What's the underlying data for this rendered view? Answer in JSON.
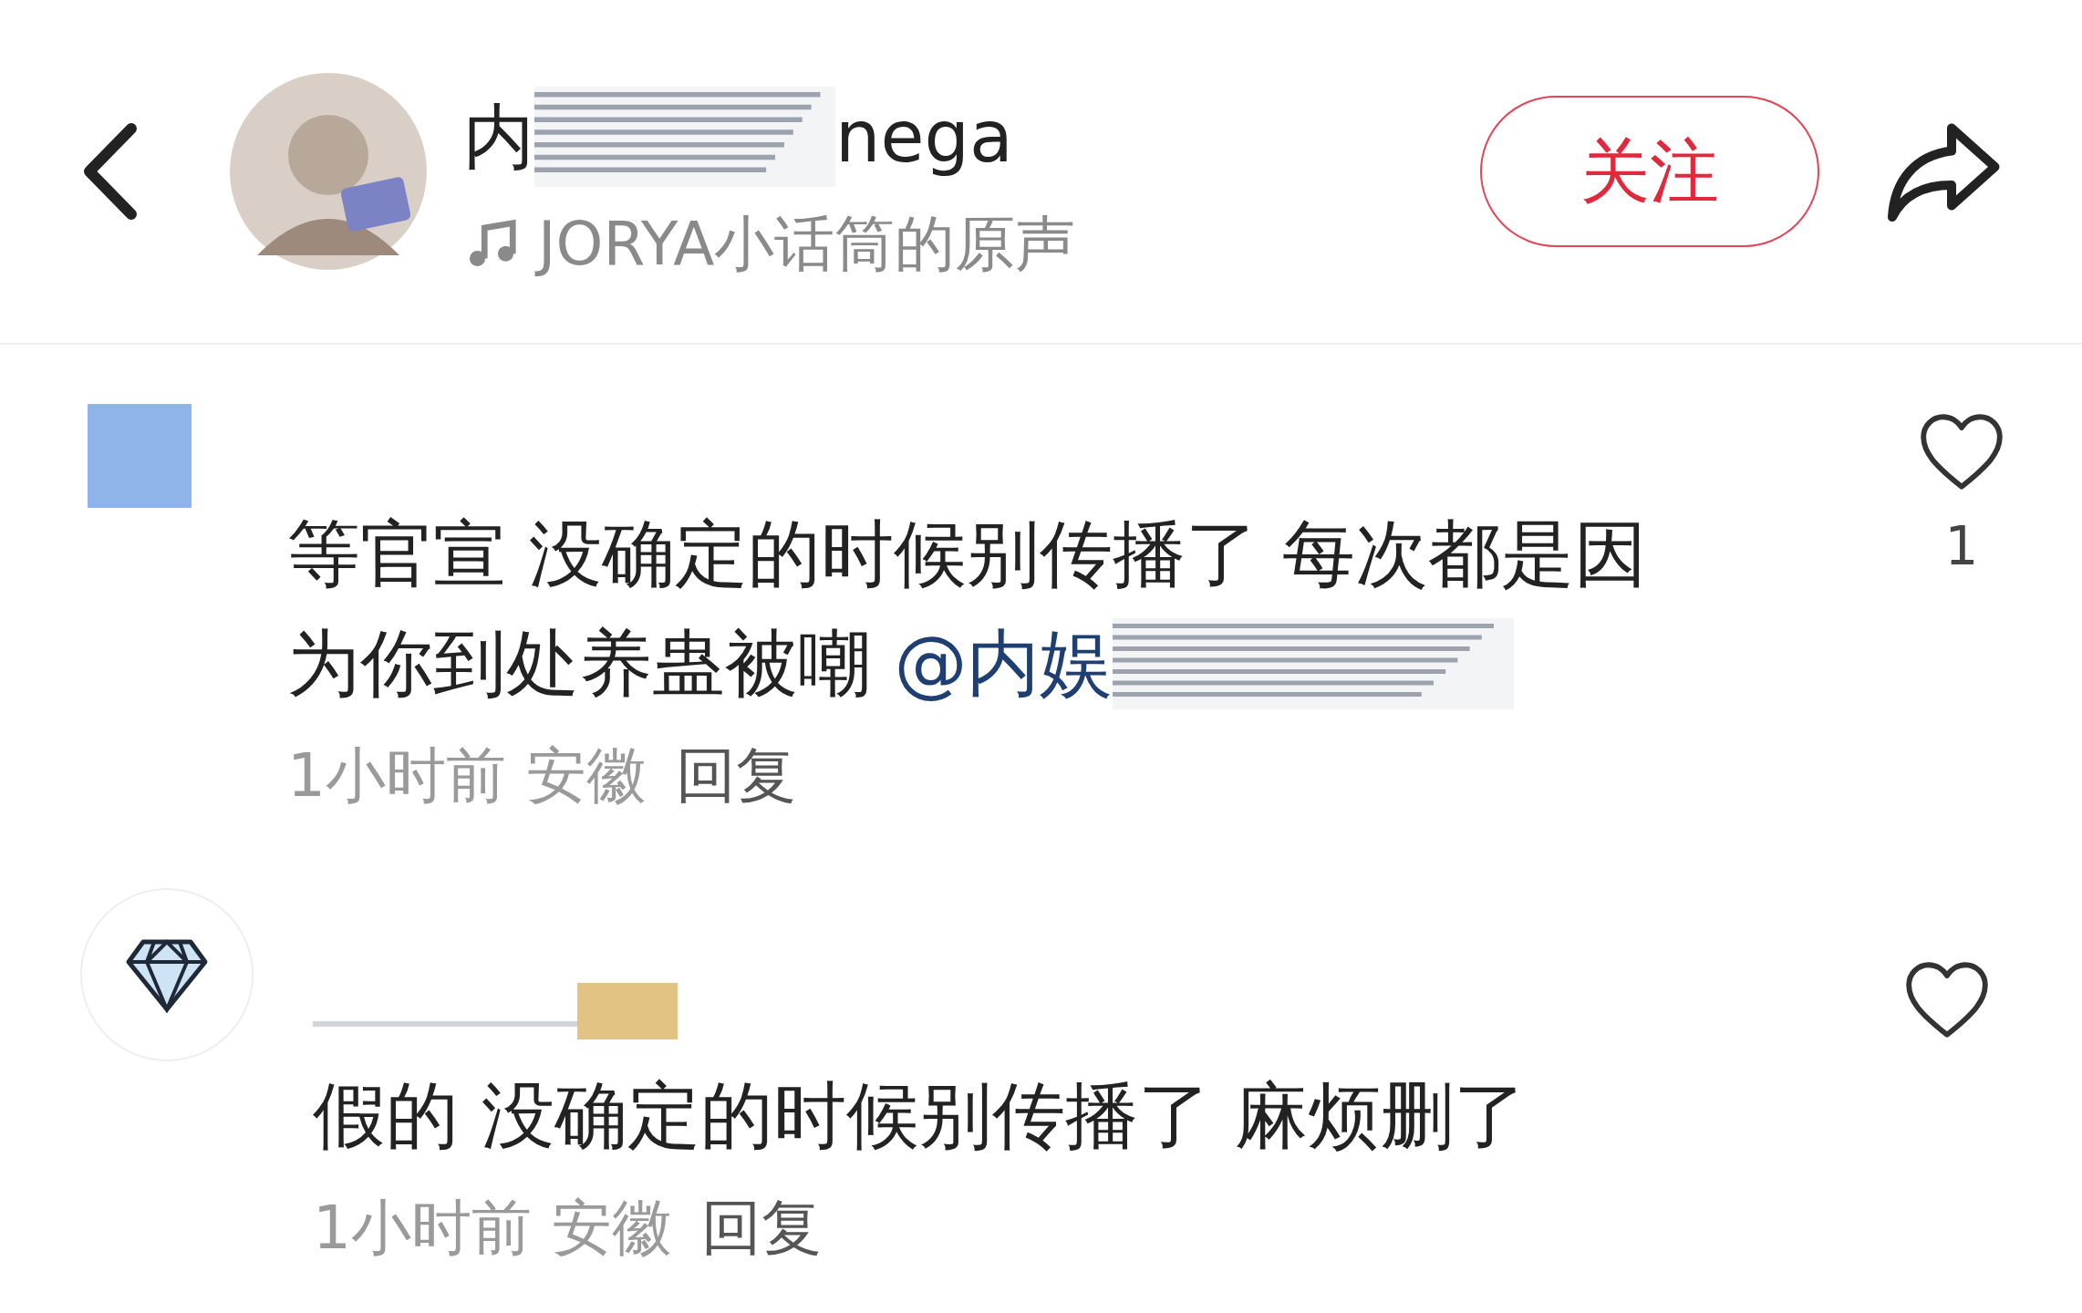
{
  "header": {
    "author_name_start": "内",
    "author_name_end": "nega",
    "sound": "JORYA小话筒的原声",
    "follow_button": "关注"
  },
  "comments": [
    {
      "avatar": {
        "kind": "square"
      },
      "lines": [
        "等官宣 没确定的时候别传播了 每次都是因",
        "为你到处养蛊被嘲 "
      ],
      "mention": "@内娱",
      "time": "1小时前",
      "region": "安徽",
      "reply": "回复",
      "likes": "1",
      "liked": false
    },
    {
      "avatar": {
        "kind": "diamond"
      },
      "author": {
        "kind": "redacted"
      },
      "lines": [
        "假的 没确定的时候别传播了 麻烦删了"
      ],
      "time": "1小时前",
      "region": "安徽",
      "reply": "回复",
      "liked": false
    }
  ]
}
